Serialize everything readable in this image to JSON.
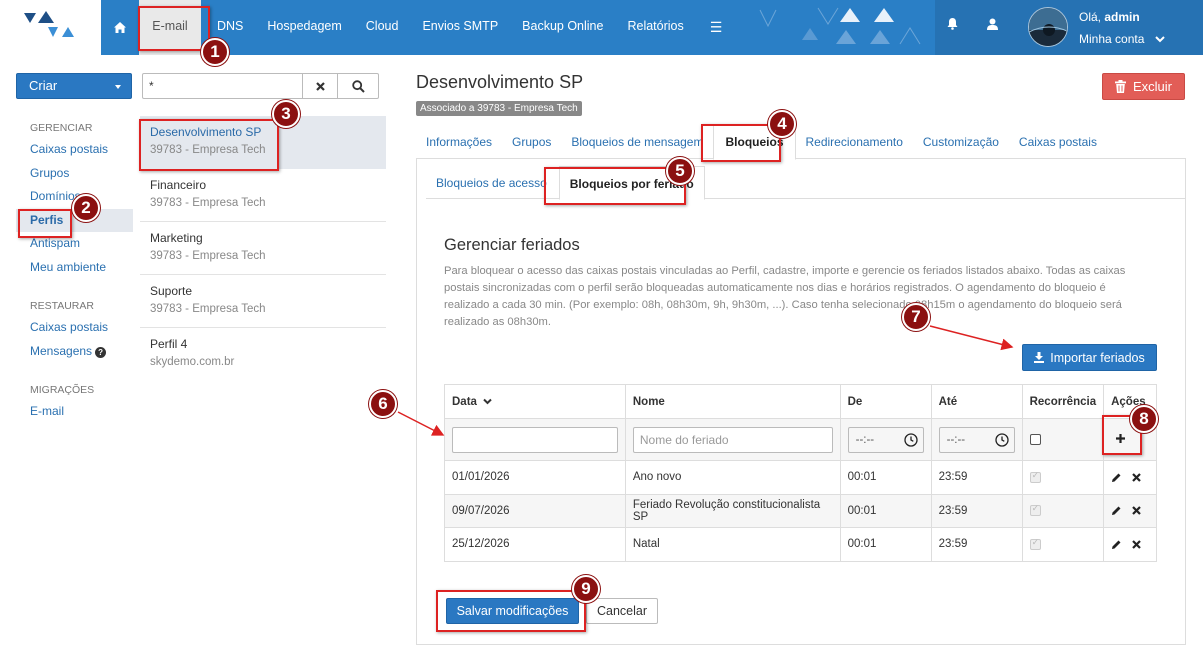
{
  "nav": {
    "items": [
      "E-mail",
      "DNS",
      "Hospedagem",
      "Cloud",
      "Envios SMTP",
      "Backup Online",
      "Relatórios"
    ],
    "greeting_prefix": "Olá, ",
    "user_name": "admin",
    "account_label": "Minha conta"
  },
  "sidebar": {
    "create_label": "Criar",
    "sections": [
      {
        "title": "GERENCIAR",
        "items": [
          "Caixas postais",
          "Grupos",
          "Domínios",
          "Perfis",
          "Antispam",
          "Meu ambiente"
        ]
      },
      {
        "title": "RESTAURAR",
        "items": [
          "Caixas postais",
          "Mensagens"
        ]
      },
      {
        "title": "MIGRAÇÕES",
        "items": [
          "E-mail"
        ]
      }
    ]
  },
  "search": {
    "value": "*"
  },
  "profiles": [
    {
      "name": "Desenvolvimento SP",
      "sub": "39783 - Empresa Tech"
    },
    {
      "name": "Financeiro",
      "sub": "39783 - Empresa Tech"
    },
    {
      "name": "Marketing",
      "sub": "39783 - Empresa Tech"
    },
    {
      "name": "Suporte",
      "sub": "39783 - Empresa Tech"
    },
    {
      "name": "Perfil 4",
      "sub": "skydemo.com.br"
    }
  ],
  "main": {
    "title": "Desenvolvimento SP",
    "assoc": "Associado a 39783 - Empresa Tech",
    "delete_label": "Excluir",
    "tabs": [
      "Informações",
      "Grupos",
      "Bloqueios de mensagem",
      "Bloqueios",
      "Redirecionamento",
      "Customização",
      "Caixas postais"
    ],
    "subtabs": [
      "Bloqueios de acesso",
      "Bloqueios por feriado"
    ],
    "section_title": "Gerenciar feriados",
    "description": "Para bloquear o acesso das caixas postais vinculadas ao Perfil, cadastre, importe e gerencie os feriados listados abaixo. Todas as caixas postais sincronizadas com o perfil serão bloqueadas automaticamente nos dias e horários registrados. O agendamento do bloqueio é realizado a cada 30 min. (Por exemplo: 08h, 08h30m, 9h, 9h30m, ...). Caso tenha selecionado 08h15m o agendamento do bloqueio será realizado as 08h30m.",
    "import_label": "Importar feriados",
    "save_label": "Salvar modificações",
    "cancel_label": "Cancelar"
  },
  "table": {
    "headers": [
      "Data",
      "Nome",
      "De",
      "Até",
      "Recorrência",
      "Ações"
    ],
    "name_placeholder": "Nome do feriado",
    "time_placeholder": "--:--",
    "rows": [
      {
        "date": "01/01/2026",
        "name": "Ano novo",
        "from": "00:01",
        "to": "23:59"
      },
      {
        "date": "09/07/2026",
        "name": "Feriado Revolução constitucionalista SP",
        "from": "00:01",
        "to": "23:59"
      },
      {
        "date": "25/12/2026",
        "name": "Natal",
        "from": "00:01",
        "to": "23:59"
      }
    ]
  },
  "annotations": [
    "1",
    "2",
    "3",
    "4",
    "5",
    "6",
    "7",
    "8",
    "9"
  ],
  "colors": {
    "brand": "#2a7fc6",
    "primary_button": "#2a78c2",
    "danger": "#e25d57",
    "annotation": "#d22222"
  }
}
